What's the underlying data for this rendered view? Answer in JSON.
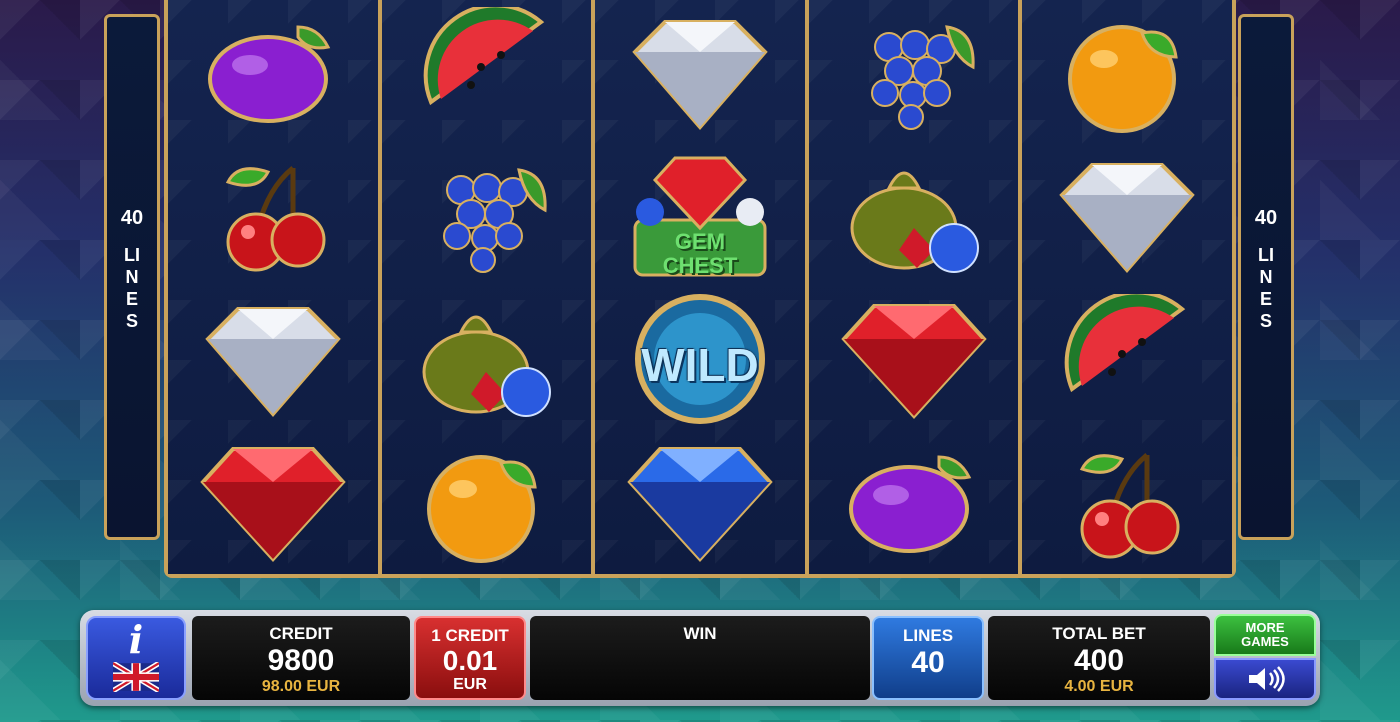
{
  "side_panels": {
    "lines_count": "40",
    "lines_word": "LINES"
  },
  "reels": [
    [
      "plum-icon",
      "cherries-icon",
      "white-diamond-icon",
      "red-gem-icon"
    ],
    [
      "watermelon-icon",
      "grapes-icon",
      "money-bag-icon",
      "orange-icon"
    ],
    [
      "white-diamond-icon",
      "gem-chest-icon",
      "wild-icon",
      "blue-diamond-icon"
    ],
    [
      "grapes-icon",
      "money-bag-icon",
      "red-gem-icon",
      "plum-icon"
    ],
    [
      "orange-icon",
      "white-diamond-icon",
      "watermelon-icon",
      "cherries-icon"
    ]
  ],
  "symbols": {
    "gem_chest_line1": "GEM",
    "gem_chest_line2": "CHEST",
    "wild": "WILD"
  },
  "bar": {
    "credit_label": "CREDIT",
    "credit_value": "9800",
    "credit_money": "98.00 EUR",
    "denom_label": "1 CREDIT",
    "denom_value": "0.01",
    "denom_currency": "EUR",
    "win_label": "WIN",
    "lines_label": "LINES",
    "lines_value": "40",
    "total_bet_label": "TOTAL BET",
    "total_bet_value": "400",
    "total_bet_money": "4.00 EUR",
    "more_games_line1": "MORE",
    "more_games_line2": "GAMES"
  },
  "colors": {
    "frame_gold": "#c9a25a",
    "reel_bg": "#14244f",
    "money_gold": "#e8b440"
  }
}
